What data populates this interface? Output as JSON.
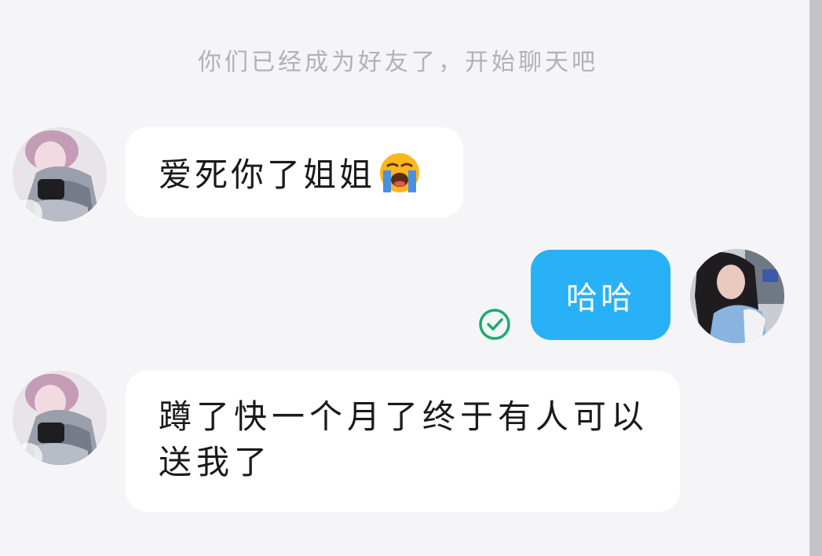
{
  "chat": {
    "system_notice": "你们已经成为好友了，开始聊天吧",
    "messages": [
      {
        "direction": "incoming",
        "text": "爱死你了姐姐",
        "emoji": "loudly-crying-face"
      },
      {
        "direction": "outgoing",
        "text": "哈哈",
        "status": "read"
      },
      {
        "direction": "incoming",
        "text": "蹲了快一个月了终于有人可以送我了"
      }
    ]
  },
  "colors": {
    "background": "#f5f5f7",
    "incoming_bubble": "#ffffff",
    "outgoing_bubble": "#28b1f7",
    "read_check": "#1aad6e",
    "notice_text": "#b2b2b2"
  },
  "icons": {
    "read_status": "check-circle-icon"
  }
}
